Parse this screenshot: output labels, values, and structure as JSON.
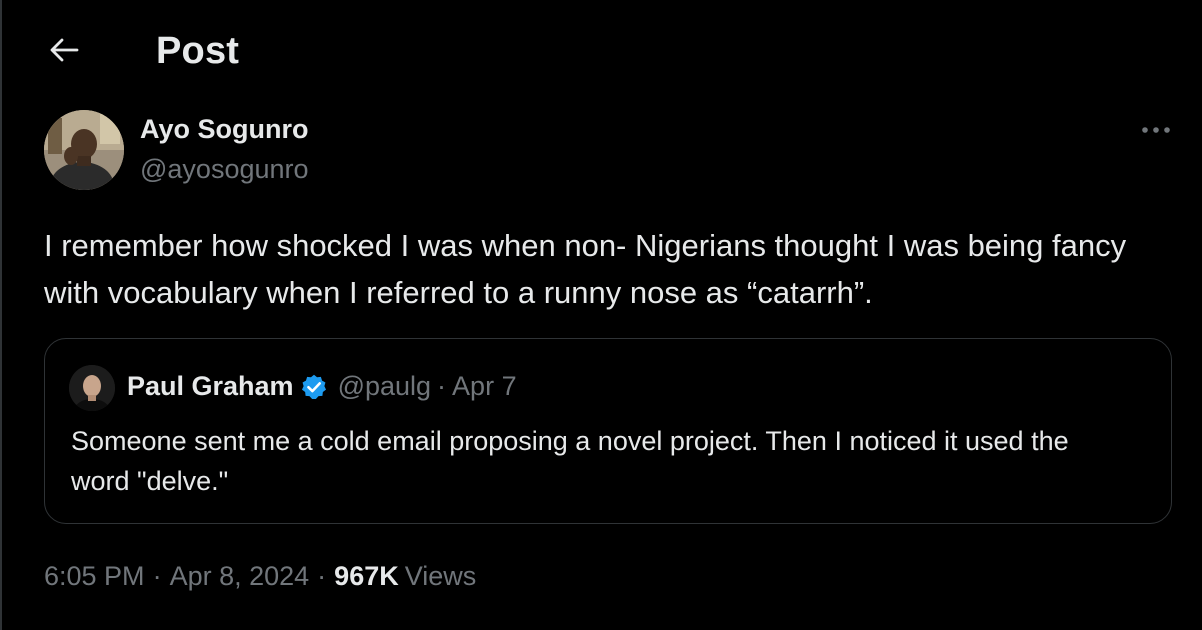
{
  "header": {
    "title": "Post",
    "back_icon": "arrow-left-icon"
  },
  "post": {
    "author": {
      "name": "Ayo Sogunro",
      "handle": "@ayosogunro"
    },
    "more_icon": "more-horizontal-icon",
    "text": "I remember how shocked I was when non- Nigerians thought I was being fancy with vocabulary when I referred to a runny nose as “catarrh”.",
    "quoted": {
      "author_name": "Paul Graham",
      "verified_icon": "verified-badge-icon",
      "handle": "@paulg",
      "separator": "·",
      "date": "Apr 7",
      "text": "Someone sent me a cold email proposing a novel project. Then I noticed it used the word \"delve.\""
    },
    "meta": {
      "time": "6:05 PM",
      "separator": "·",
      "date": "Apr 8, 2024",
      "views_count": "967K",
      "views_label": "Views"
    }
  },
  "colors": {
    "background": "#000000",
    "text_primary": "#e7e9ea",
    "text_secondary": "#71767b",
    "border": "#2f3336",
    "verified_blue": "#1d9bf0"
  }
}
